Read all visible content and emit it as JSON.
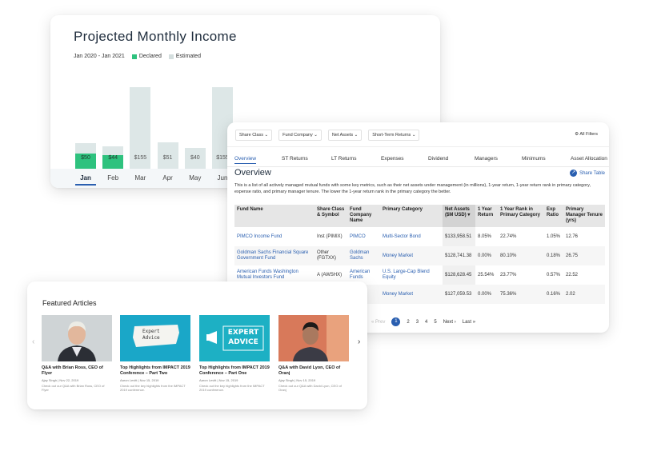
{
  "income": {
    "title": "Projected Monthly Income",
    "date_range": "Jan 2020 - Jan 2021",
    "legend_declared": "Declared",
    "legend_estimated": "Estimated",
    "colors": {
      "declared": "#2ec27e",
      "estimated": "#dde7e7",
      "accent": "#2a5fb0"
    },
    "months": [
      "Jan",
      "Feb",
      "Mar",
      "Apr",
      "May",
      "Jun"
    ],
    "active_month": "Jan"
  },
  "chart_data": {
    "type": "bar",
    "categories": [
      "Jan",
      "Feb",
      "Mar",
      "Apr",
      "May",
      "Jun"
    ],
    "series": [
      {
        "name": "Declared",
        "values": [
          50,
          44,
          0,
          0,
          0,
          0
        ]
      },
      {
        "name": "Estimated",
        "values": [
          50,
          44,
          155,
          51,
          40,
          155
        ]
      }
    ],
    "value_labels": [
      "$50",
      "$44",
      "$155",
      "$51",
      "$40",
      "$155"
    ],
    "ylim": [
      0,
      200
    ]
  },
  "fund_table": {
    "filters": [
      "Share Class",
      "Fund Company",
      "Net Assets",
      "Short-Term Returns"
    ],
    "all_filters": "All Filters",
    "tabs": [
      "Overview",
      "ST Returns",
      "LT Returns",
      "Expenses",
      "Dividend",
      "Managers",
      "Minimums",
      "Asset Allocation"
    ],
    "heading": "Overview",
    "share_label": "Share Table",
    "description": "This is a list of all actively managed mutual funds with some key metrics, such as their net assets under management (in millions), 1-year return, 1-year return rank in primary category, expense ratio, and primary manager tenure. The lower the 1-year return rank in the primary category the better.",
    "columns": [
      "Fund Name",
      "Share Class & Symbol",
      "Fund Company Name",
      "Primary Category",
      "Net Assets ($M USD)",
      "1 Year Return",
      "1 Year Rank in Primary Category",
      "Exp Ratio",
      "Primary Manager Tenure (yrs)"
    ],
    "rows": [
      [
        "PIMCO Income Fund",
        "Inst (PIMIX)",
        "PIMCO",
        "Multi-Sector Bond",
        "$133,958.51",
        "8.05%",
        "22.74%",
        "1.05%",
        "12.76"
      ],
      [
        "Goldman Sachs Financial Square Government Fund",
        "Other (FGTXX)",
        "Goldman Sachs",
        "Money Market",
        "$128,741.38",
        "0.00%",
        "80.10%",
        "0.18%",
        "26.75"
      ],
      [
        "American Funds Washington Mutual Investors Fund",
        "A (AWSHX)",
        "American Funds",
        "U.S. Large-Cap Blend Equity",
        "$128,628.45",
        "25.54%",
        "23.77%",
        "0.57%",
        "22.52"
      ],
      [
        "",
        "",
        "d",
        "Money Market",
        "$127,059.53",
        "0.00%",
        "75.36%",
        "0.16%",
        "2.02"
      ]
    ],
    "pagination": {
      "prev": "Prev",
      "pages": [
        "1",
        "2",
        "3",
        "4",
        "5"
      ],
      "next": "Next",
      "last": "Last"
    }
  },
  "featured": {
    "title": "Featured Articles",
    "articles": [
      {
        "title": "Q&A with Brian Ross, CEO of Flyer",
        "meta": "Ajay Singh | Nov 22, 2019",
        "desc": "Check out our Q&A with Brian Ross, CEO of Flyer"
      },
      {
        "title": "Top Highlights from IMPACT 2019 Conference – Part Two",
        "meta": "Aaron Levitt | Nov 15, 2019",
        "desc": "Check out the key highlights from the IMPACT 2019 conference.",
        "image_text": [
          "Expert",
          "Advice"
        ]
      },
      {
        "title": "Top Highlights from IMPACT 2019 Conference – Part One",
        "meta": "Aaron Levitt | Nov 15, 2019",
        "desc": "Check out the key highlights from the IMPACT 2019 conference.",
        "image_text": [
          "EXPERT",
          "ADVICE"
        ]
      },
      {
        "title": "Q&A with David Lyon, CEO of Oranj",
        "meta": "Ajay Singh | Nov 15, 2019",
        "desc": "Check out our Q&A with David Lyon, CEO of Oranj"
      }
    ]
  }
}
